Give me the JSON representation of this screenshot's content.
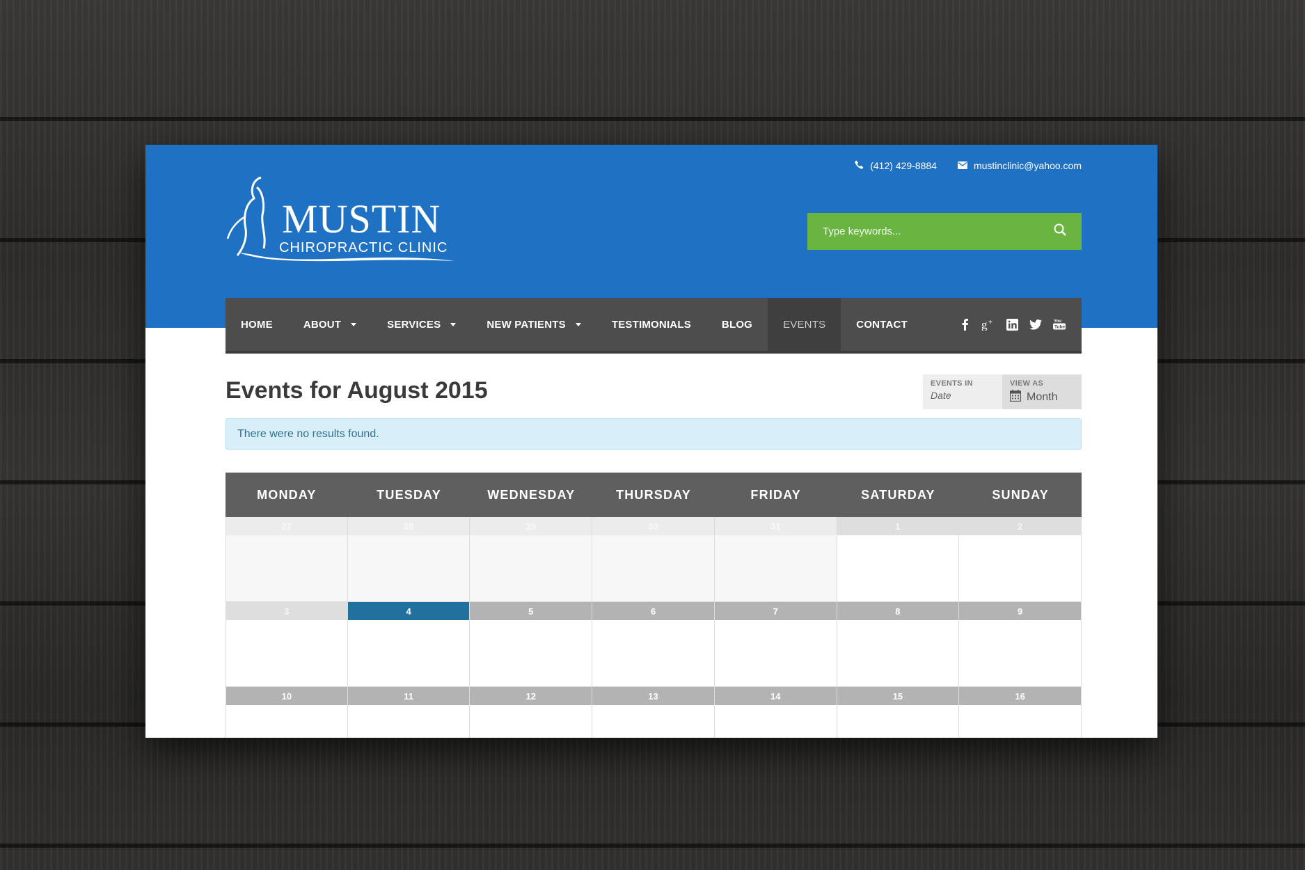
{
  "header": {
    "phone": "(412) 429-8884",
    "email": "mustinclinic@yahoo.com",
    "logo": {
      "name": "MUSTIN",
      "tagline": "CHIROPRACTIC CLINIC"
    },
    "search_placeholder": "Type keywords..."
  },
  "nav": {
    "items": [
      {
        "label": "HOME",
        "dropdown": false
      },
      {
        "label": "ABOUT",
        "dropdown": true
      },
      {
        "label": "SERVICES",
        "dropdown": true
      },
      {
        "label": "NEW PATIENTS",
        "dropdown": true
      },
      {
        "label": "TESTIMONIALS",
        "dropdown": false
      },
      {
        "label": "BLOG",
        "dropdown": false
      },
      {
        "label": "EVENTS",
        "dropdown": false,
        "active": true
      },
      {
        "label": "CONTACT",
        "dropdown": false
      }
    ],
    "social_icons": [
      "facebook-icon",
      "google-plus-icon",
      "linkedin-icon",
      "twitter-icon",
      "youtube-icon"
    ]
  },
  "main": {
    "title": "Events for August 2015",
    "events_in": {
      "label": "EVENTS IN",
      "placeholder": "Date"
    },
    "view_as": {
      "label": "VIEW AS",
      "value": "Month"
    },
    "notice": "There were no results found."
  },
  "calendar": {
    "weekdays": [
      "MONDAY",
      "TUESDAY",
      "WEDNESDAY",
      "THURSDAY",
      "FRIDAY",
      "SATURDAY",
      "SUNDAY"
    ],
    "weeks": [
      [
        {
          "day": "27",
          "state": "other"
        },
        {
          "day": "28",
          "state": "other"
        },
        {
          "day": "29",
          "state": "other"
        },
        {
          "day": "30",
          "state": "other"
        },
        {
          "day": "31",
          "state": "other"
        },
        {
          "day": "1",
          "state": "past"
        },
        {
          "day": "2",
          "state": "past"
        }
      ],
      [
        {
          "day": "3",
          "state": "past"
        },
        {
          "day": "4",
          "state": "today"
        },
        {
          "day": "5",
          "state": "future"
        },
        {
          "day": "6",
          "state": "future"
        },
        {
          "day": "7",
          "state": "future"
        },
        {
          "day": "8",
          "state": "future"
        },
        {
          "day": "9",
          "state": "future"
        }
      ],
      [
        {
          "day": "10",
          "state": "future"
        },
        {
          "day": "11",
          "state": "future"
        },
        {
          "day": "12",
          "state": "future"
        },
        {
          "day": "13",
          "state": "future"
        },
        {
          "day": "14",
          "state": "future"
        },
        {
          "day": "15",
          "state": "future"
        },
        {
          "day": "16",
          "state": "future"
        }
      ]
    ]
  },
  "colors": {
    "header_blue": "#1f71c4",
    "search_green": "#6ab541",
    "nav_dark": "#4d4d4d",
    "today_blue": "#21709e",
    "notice_bg": "#d8eef8"
  }
}
